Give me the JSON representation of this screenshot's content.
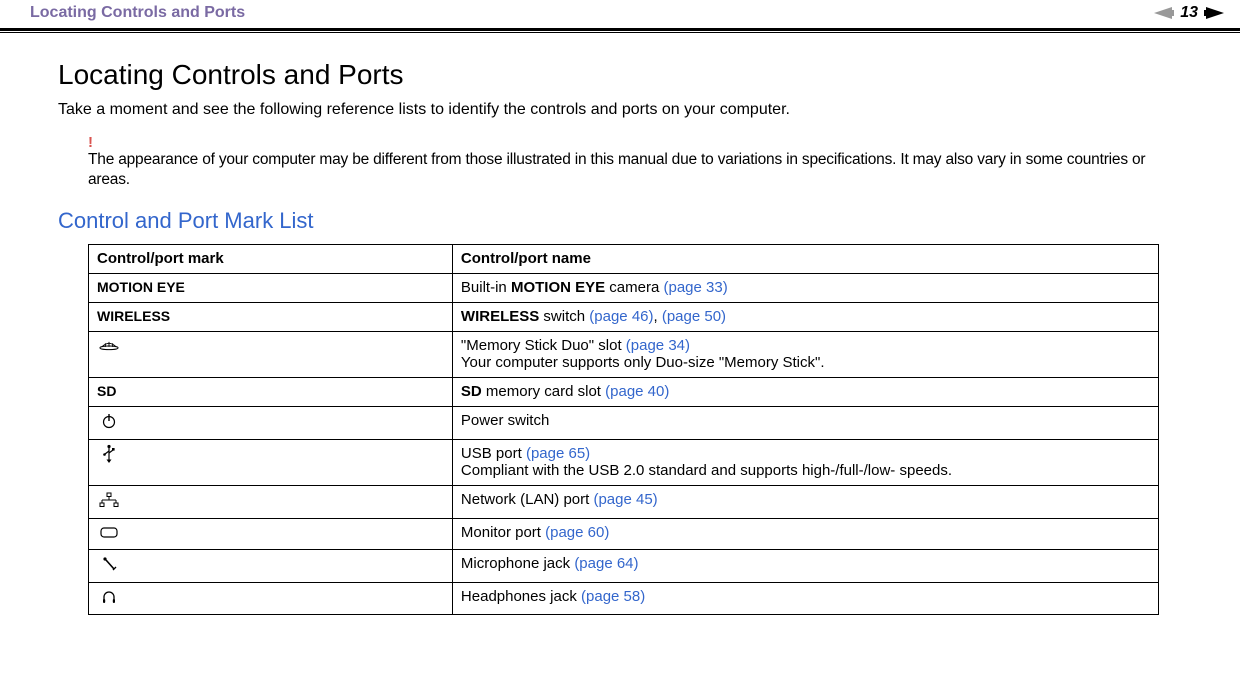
{
  "header": {
    "title": "Locating Controls and Ports",
    "page_number": "13"
  },
  "main": {
    "heading": "Locating Controls and Ports",
    "intro": "Take a moment and see the following reference lists to identify the controls and ports on your computer.",
    "note_symbol": "!",
    "note": "The appearance of your computer may be different from those illustrated in this manual due to variations in specifications. It may also vary in some countries or areas.",
    "subheading": "Control and Port Mark List"
  },
  "table": {
    "headers": {
      "mark": "Control/port mark",
      "name": "Control/port name"
    },
    "rows": [
      {
        "mark_type": "text",
        "mark": "MOTION EYE",
        "name_prefix": "Built-in ",
        "name_bold": "MOTION EYE",
        "name_suffix": " camera ",
        "links": [
          "(page 33)"
        ],
        "extra": ""
      },
      {
        "mark_type": "text",
        "mark": "WIRELESS",
        "name_prefix": "",
        "name_bold": "WIRELESS",
        "name_suffix": " switch ",
        "links": [
          "(page 46)",
          "(page 50)"
        ],
        "link_sep": ", ",
        "extra": ""
      },
      {
        "mark_type": "icon",
        "mark_icon": "memory-stick-icon",
        "name_prefix": "\"Memory Stick Duo\" slot ",
        "name_bold": "",
        "name_suffix": "",
        "links": [
          "(page 34)"
        ],
        "extra": "Your computer supports only Duo-size \"Memory Stick\"."
      },
      {
        "mark_type": "text",
        "mark": "SD",
        "name_prefix": "",
        "name_bold": "SD",
        "name_suffix": " memory card slot ",
        "links": [
          "(page 40)"
        ],
        "extra": ""
      },
      {
        "mark_type": "icon",
        "mark_icon": "power-icon",
        "name_prefix": "Power switch",
        "name_bold": "",
        "name_suffix": "",
        "links": [],
        "extra": ""
      },
      {
        "mark_type": "icon",
        "mark_icon": "usb-icon",
        "name_prefix": "USB port ",
        "name_bold": "",
        "name_suffix": "",
        "links": [
          "(page 65)"
        ],
        "extra": "Compliant with the USB 2.0 standard and supports high-/full-/low- speeds."
      },
      {
        "mark_type": "icon",
        "mark_icon": "lan-icon",
        "name_prefix": "Network (LAN) port ",
        "name_bold": "",
        "name_suffix": "",
        "links": [
          "(page 45)"
        ],
        "extra": ""
      },
      {
        "mark_type": "icon",
        "mark_icon": "monitor-icon",
        "name_prefix": "Monitor port ",
        "name_bold": "",
        "name_suffix": "",
        "links": [
          "(page 60)"
        ],
        "extra": ""
      },
      {
        "mark_type": "icon",
        "mark_icon": "mic-icon",
        "name_prefix": "Microphone jack ",
        "name_bold": "",
        "name_suffix": "",
        "links": [
          "(page 64)"
        ],
        "extra": ""
      },
      {
        "mark_type": "icon",
        "mark_icon": "headphones-icon",
        "name_prefix": "Headphones jack ",
        "name_bold": "",
        "name_suffix": "",
        "links": [
          "(page 58)"
        ],
        "extra": ""
      }
    ]
  }
}
